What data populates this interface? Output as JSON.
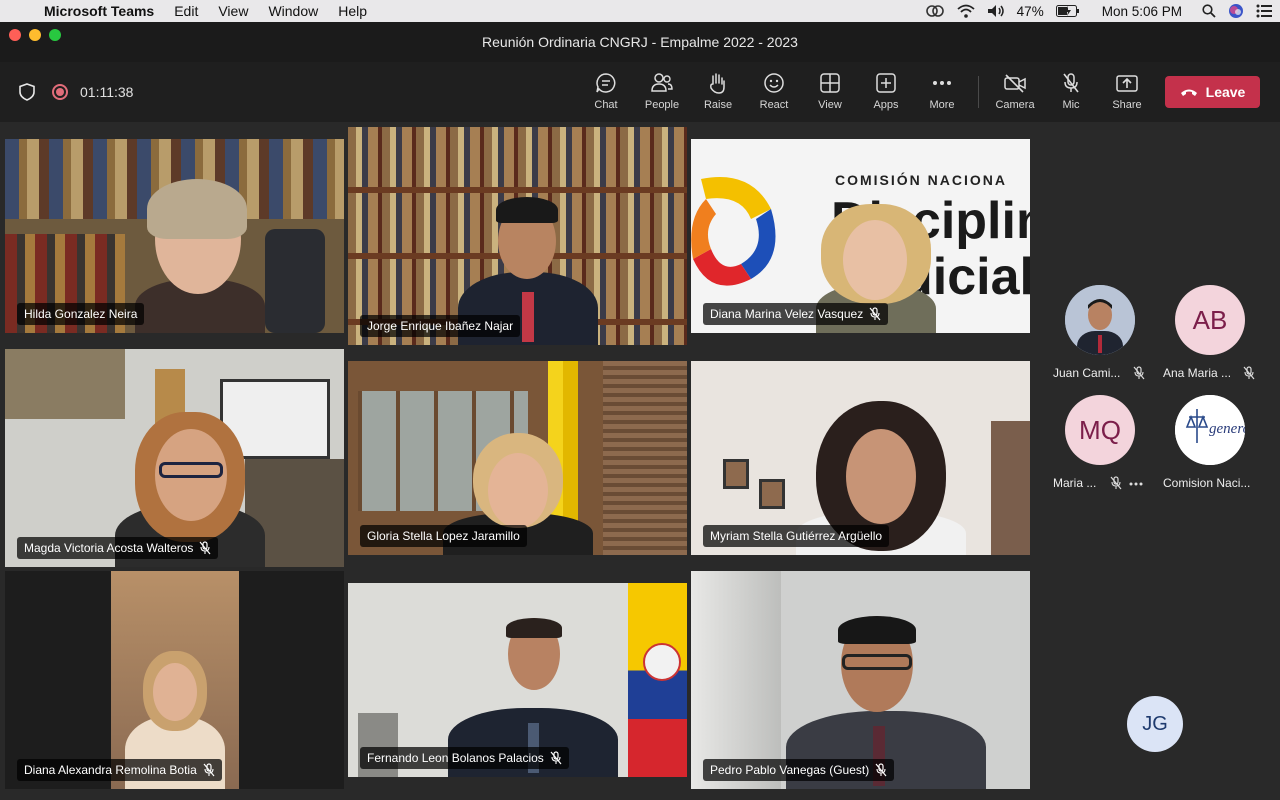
{
  "menubar": {
    "app": "Microsoft Teams",
    "items": [
      "Edit",
      "View",
      "Window",
      "Help"
    ],
    "battery": "47%",
    "clock": "Mon 5:06 PM"
  },
  "window": {
    "title": "Reunión Ordinaria CNGRJ - Empalme 2022 - 2023"
  },
  "toolbar": {
    "timer": "01:11:38",
    "buttons": {
      "chat": "Chat",
      "people": "People",
      "raise": "Raise",
      "react": "React",
      "view": "View",
      "apps": "Apps",
      "more": "More",
      "camera": "Camera",
      "mic": "Mic",
      "share": "Share"
    },
    "leave": "Leave",
    "leave_color": "#c4314b"
  },
  "participants": [
    {
      "name": "Hilda Gonzalez Neira",
      "muted": false
    },
    {
      "name": "Jorge Enrique Ibañez Najar",
      "muted": false
    },
    {
      "name": "Diana Marina Velez Vasquez",
      "muted": true
    },
    {
      "name": "Magda Victoria Acosta Walteros",
      "muted": true
    },
    {
      "name": "Gloria Stella Lopez Jaramillo",
      "muted": false
    },
    {
      "name": "Myriam Stella Gutiérrez Argüello",
      "muted": false
    },
    {
      "name": "Diana Alexandra Remolina Botia",
      "muted": true
    },
    {
      "name": "Fernando Leon Bolanos Palacios",
      "muted": true
    },
    {
      "name": "Pedro Pablo Vanegas (Guest)",
      "muted": true
    }
  ],
  "backdrop_text": {
    "line1": "COMISIÓN NACIONA",
    "line2": "Disciplin",
    "line3": "dicial"
  },
  "roster": [
    {
      "name": "Juan Cami...",
      "initials": ""
    },
    {
      "name": "Ana Maria ...",
      "initials": "AB"
    },
    {
      "name": "Maria ...",
      "initials": "MQ"
    },
    {
      "name": "Comision Naci...",
      "initials": ""
    }
  ],
  "roster_logo_text": "genero",
  "floating_initials": "JG"
}
